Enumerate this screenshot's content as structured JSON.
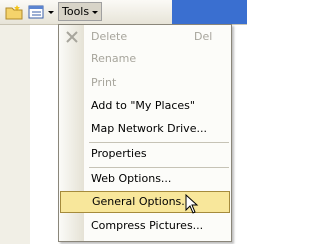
{
  "toolbar": {
    "tools_label": "Tools"
  },
  "menu": {
    "items": [
      {
        "label": "Delete",
        "shortcut": "Del",
        "disabled": true
      },
      {
        "label": "Rename",
        "disabled": true
      },
      {
        "label": "Print",
        "disabled": true
      },
      {
        "label": "Add to \"My Places\""
      },
      {
        "label": "Map Network Drive..."
      },
      {
        "label": "Properties"
      },
      {
        "label": "Web Options..."
      },
      {
        "label": "General Options...",
        "highlighted": true
      },
      {
        "label": "Compress Pictures..."
      }
    ]
  },
  "colors": {
    "highlight_bg": "#f8e79b",
    "highlight_border": "#a58b3c",
    "disabled_text": "#a7a59c",
    "title_blue": "#3a6fd0"
  },
  "icons": {
    "folder": "new-folder-icon",
    "views": "views-icon",
    "delete": "delete-x-icon",
    "cursor": "mouse-pointer-icon"
  }
}
